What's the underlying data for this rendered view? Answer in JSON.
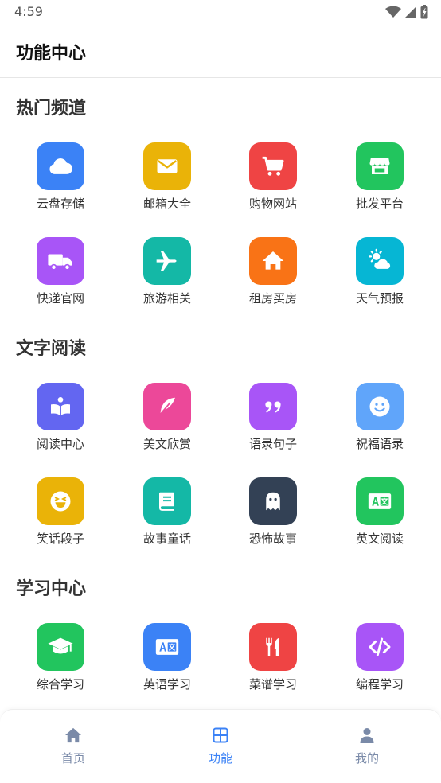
{
  "status_bar": {
    "time": "4:59",
    "icons": [
      "wifi-icon",
      "signal-icon",
      "battery-icon"
    ]
  },
  "header": {
    "title": "功能中心"
  },
  "colors": {
    "accent": "#3b82f6",
    "inactive_tab": "#7a8aa8",
    "blue": "#3b82f6",
    "yellow": "#eab308",
    "red": "#ef4444",
    "green": "#22c55e",
    "purple": "#a855f7",
    "teal": "#14b8a6",
    "orange": "#f97316",
    "cyan": "#06b6d4",
    "indigo": "#6366f1",
    "pink": "#ec4899",
    "sky": "#60a5fa",
    "slate": "#334155"
  },
  "sections": [
    {
      "title": "热门频道",
      "items": [
        {
          "label": "云盘存储",
          "icon": "cloud-icon",
          "color": "#3b82f6"
        },
        {
          "label": "邮箱大全",
          "icon": "envelope-icon",
          "color": "#eab308"
        },
        {
          "label": "购物网站",
          "icon": "cart-icon",
          "color": "#ef4444"
        },
        {
          "label": "批发平台",
          "icon": "store-icon",
          "color": "#22c55e"
        },
        {
          "label": "快递官网",
          "icon": "truck-icon",
          "color": "#a855f7"
        },
        {
          "label": "旅游相关",
          "icon": "plane-icon",
          "color": "#14b8a6"
        },
        {
          "label": "租房买房",
          "icon": "house-icon",
          "color": "#f97316"
        },
        {
          "label": "天气预报",
          "icon": "weather-icon",
          "color": "#06b6d4"
        }
      ]
    },
    {
      "title": "文字阅读",
      "items": [
        {
          "label": "阅读中心",
          "icon": "reader-icon",
          "color": "#6366f1"
        },
        {
          "label": "美文欣赏",
          "icon": "feather-icon",
          "color": "#ec4899"
        },
        {
          "label": "语录句子",
          "icon": "quote-icon",
          "color": "#a855f7"
        },
        {
          "label": "祝福语录",
          "icon": "smile-icon",
          "color": "#60a5fa"
        },
        {
          "label": "笑话段子",
          "icon": "laugh-icon",
          "color": "#eab308"
        },
        {
          "label": "故事童话",
          "icon": "book-icon",
          "color": "#14b8a6"
        },
        {
          "label": "恐怖故事",
          "icon": "ghost-icon",
          "color": "#334155"
        },
        {
          "label": "英文阅读",
          "icon": "translate-icon",
          "color": "#22c55e"
        }
      ]
    },
    {
      "title": "学习中心",
      "items": [
        {
          "label": "综合学习",
          "icon": "graduation-cap-icon",
          "color": "#22c55e"
        },
        {
          "label": "英语学习",
          "icon": "translate-icon",
          "color": "#3b82f6"
        },
        {
          "label": "菜谱学习",
          "icon": "utensils-icon",
          "color": "#ef4444"
        },
        {
          "label": "编程学习",
          "icon": "code-icon",
          "color": "#a855f7"
        }
      ]
    }
  ],
  "tab_bar": {
    "active_index": 1,
    "tabs": [
      {
        "label": "首页",
        "icon": "home-icon"
      },
      {
        "label": "功能",
        "icon": "grid-icon"
      },
      {
        "label": "我的",
        "icon": "user-icon"
      }
    ]
  }
}
